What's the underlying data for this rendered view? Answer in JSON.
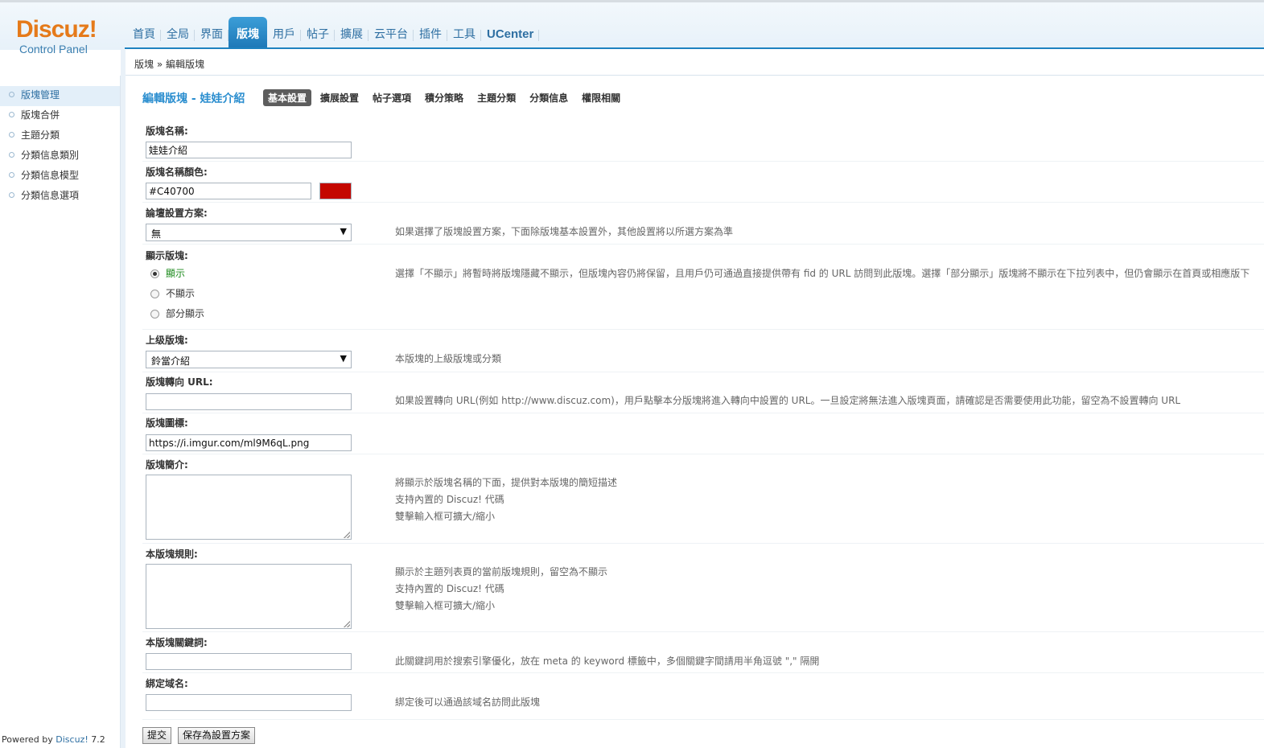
{
  "logo": {
    "main": "Discuz!",
    "sub": "Control Panel"
  },
  "topnav": [
    "首頁",
    "全局",
    "界面",
    "版塊",
    "用戶",
    "帖子",
    "擴展",
    "云平台",
    "插件",
    "工具",
    "UCenter"
  ],
  "topnav_active": "版塊",
  "breadcrumb": "版塊 » 編輯版塊",
  "sidebar": {
    "items": [
      "版塊管理",
      "版塊合併",
      "主題分類",
      "分類信息類別",
      "分類信息模型",
      "分類信息選項"
    ],
    "active": "版塊管理"
  },
  "powered": {
    "prefix": "Powered by ",
    "brand": "Discuz!",
    "version": " 7.2"
  },
  "heading": "編輯版塊 - 娃娃介紹",
  "tabs": [
    "基本設置",
    "擴展設置",
    "帖子選項",
    "積分策略",
    "主題分類",
    "分類信息",
    "權限相關"
  ],
  "active_tab": "基本設置",
  "form": {
    "name": {
      "label": "版塊名稱:",
      "value": "娃娃介紹"
    },
    "name_color": {
      "label": "版塊名稱顏色:",
      "value": "#C40700",
      "swatch": "#C40700"
    },
    "scheme": {
      "label": "論壇設置方案:",
      "value": "無",
      "tip": "如果選擇了版塊設置方案，下面除版塊基本設置外，其他設置將以所選方案為準"
    },
    "display": {
      "label": "顯示版塊:",
      "options": [
        "顯示",
        "不顯示",
        "部分顯示"
      ],
      "selected": "顯示",
      "tip": "選擇「不顯示」將暫時將版塊隱藏不顯示，但版塊內容仍將保留，且用戶仍可通過直接提供帶有 fid 的 URL 訪問到此版塊。選擇「部分顯示」版塊將不顯示在下拉列表中，但仍會顯示在首頁或相應版下"
    },
    "parent": {
      "label": "上级版塊:",
      "value": "鈴當介紹",
      "tip": "本版塊的上級版塊或分類"
    },
    "redirect": {
      "label": "版塊轉向 URL:",
      "value": "",
      "tip": "如果設置轉向 URL(例如 http://www.discuz.com)，用戶點擊本分版塊將進入轉向中設置的 URL。一旦設定將無法進入版塊頁面，請確認是否需要使用此功能，留空為不設置轉向 URL"
    },
    "icon": {
      "label": "版塊圖標:",
      "value": "https://i.imgur.com/ml9M6qL.png"
    },
    "description": {
      "label": "版塊簡介:",
      "tips": [
        "將顯示於版塊名稱的下面，提供對本版塊的簡短描述",
        "支持內置的 Discuz! 代碼",
        "雙擊輸入框可擴大/縮小"
      ]
    },
    "rules": {
      "label": "本版塊規則:",
      "tips": [
        "顯示於主題列表頁的當前版塊規則，留空為不顯示",
        "支持內置的 Discuz! 代碼",
        "雙擊輸入框可擴大/縮小"
      ]
    },
    "keywords": {
      "label": "本版塊關鍵詞:",
      "value": "",
      "tip": "此關鍵詞用於搜索引擎優化，放在 meta 的 keyword 標籤中，多個關鍵字間請用半角逗號 \",\" 隔開"
    },
    "domain": {
      "label": "綁定域名:",
      "value": "",
      "tip": "綁定後可以通過該域名訪問此版塊"
    }
  },
  "buttons": {
    "submit": "提交",
    "save_scheme": "保存為設置方案"
  }
}
